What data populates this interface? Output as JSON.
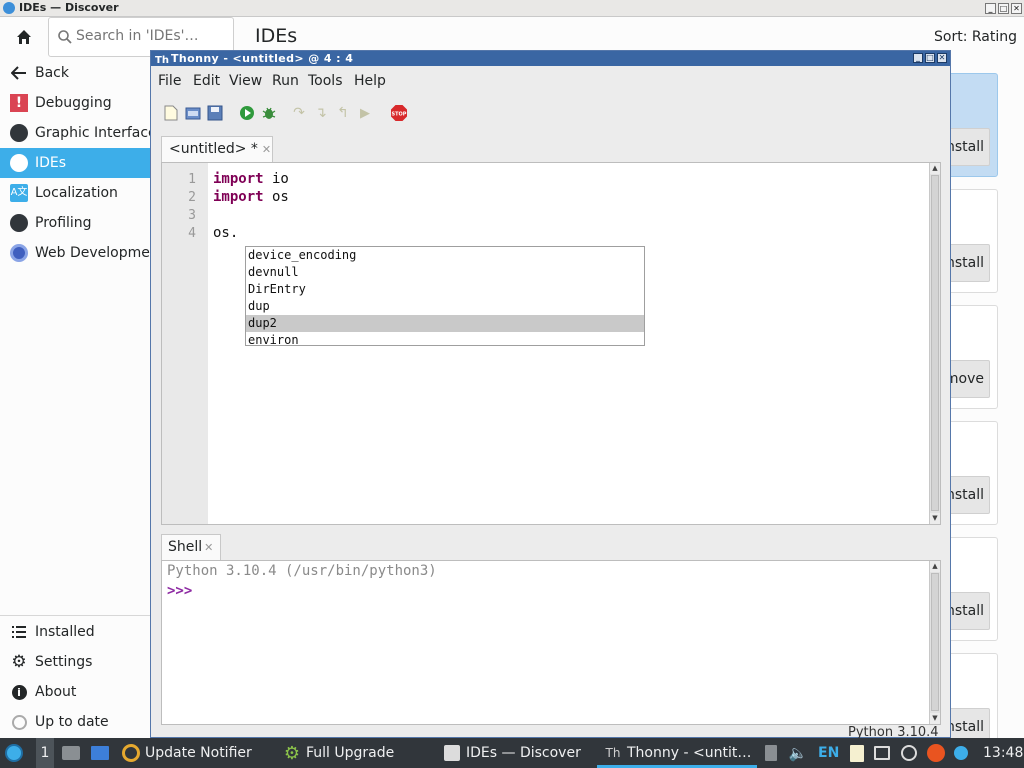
{
  "discover": {
    "window_title": "IDEs — Discover",
    "search": {
      "placeholder": "Search in 'IDEs'…",
      "value": ""
    },
    "nav": {
      "back": "Back",
      "categories": [
        {
          "label": "Debugging",
          "icon": "debugging-icon"
        },
        {
          "label": "Graphic Interface",
          "icon": "graphic-interface-icon"
        },
        {
          "label": "IDEs",
          "icon": "ides-icon",
          "active": true
        },
        {
          "label": "Localization",
          "icon": "localization-icon"
        },
        {
          "label": "Profiling",
          "icon": "profiling-icon"
        },
        {
          "label": "Web Development",
          "icon": "web-development-icon"
        }
      ],
      "bottom": [
        {
          "label": "Installed",
          "icon": "list-icon"
        },
        {
          "label": "Settings",
          "icon": "gear-icon"
        },
        {
          "label": "About",
          "icon": "info-icon"
        },
        {
          "label": "Up to date",
          "icon": "update-status-icon"
        }
      ]
    },
    "header": {
      "title": "IDEs",
      "sort": "Sort: Rating"
    },
    "cards": [
      {
        "button": "Install"
      },
      {
        "button": "Install"
      },
      {
        "button": "Remove"
      },
      {
        "button": "Install"
      },
      {
        "button": "Install"
      },
      {
        "button": "Install"
      }
    ]
  },
  "thonny": {
    "title": "Thonny  -  <untitled>  @  4 : 4",
    "menu": [
      "File",
      "Edit",
      "View",
      "Run",
      "Tools",
      "Help"
    ],
    "editor_tab": "<untitled> *",
    "editor": {
      "lines": [
        {
          "num": "1",
          "kw": "import",
          "rest": " io"
        },
        {
          "num": "2",
          "kw": "import",
          "rest": " os"
        },
        {
          "num": "3",
          "kw": "",
          "rest": ""
        },
        {
          "num": "4",
          "kw": "",
          "rest": "os."
        }
      ]
    },
    "autocomplete": {
      "items": [
        "device_encoding",
        "devnull",
        "DirEntry",
        "dup",
        "dup2",
        "environ"
      ],
      "selected_index": 4
    },
    "shell_tab": "Shell",
    "shell": {
      "banner": "Python 3.10.4 (/usr/bin/python3)",
      "prompt": ">>>"
    },
    "status": "Python 3.10.4"
  },
  "taskbar": {
    "workspace": "1",
    "items": [
      {
        "label": "Update Notifier"
      },
      {
        "label": "Full Upgrade"
      },
      {
        "label": "IDEs — Discover"
      },
      {
        "label": "Thonny  -  <untit…",
        "active": true
      }
    ],
    "keyboard_layout": "EN",
    "clock": "13:48"
  },
  "colors": {
    "accent": "#3daee9",
    "thonny_titlebar": "#3a66a3",
    "keyword": "#7f0055",
    "prompt": "#8e2ba3"
  }
}
